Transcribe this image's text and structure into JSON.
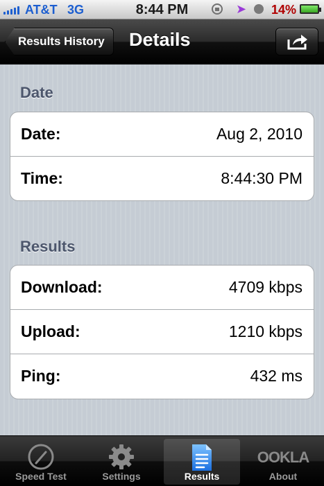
{
  "status_bar": {
    "carrier": "AT&T",
    "network": "3G",
    "time": "8:44 PM",
    "battery": "14%"
  },
  "nav": {
    "back_label": "Results History",
    "title": "Details",
    "share_icon": "share-icon"
  },
  "sections": {
    "date": {
      "header": "Date",
      "rows": [
        {
          "label": "Date:",
          "value": "Aug 2, 2010"
        },
        {
          "label": "Time:",
          "value": "8:44:30 PM"
        }
      ]
    },
    "results": {
      "header": "Results",
      "rows": [
        {
          "label": "Download:",
          "value": "4709 kbps"
        },
        {
          "label": "Upload:",
          "value": "1210 kbps"
        },
        {
          "label": "Ping:",
          "value": "432 ms"
        }
      ]
    }
  },
  "tabs": [
    {
      "label": "Speed Test",
      "icon": "speedometer-icon"
    },
    {
      "label": "Settings",
      "icon": "gear-icon"
    },
    {
      "label": "Results",
      "icon": "document-list-icon",
      "active": true
    },
    {
      "label": "About",
      "logo": "OOKLA"
    }
  ],
  "colors": {
    "status_blue": "#1d5fd0",
    "battery_red": "#b00000",
    "section_header": "#4c566c",
    "background": "#c5ccd4"
  }
}
